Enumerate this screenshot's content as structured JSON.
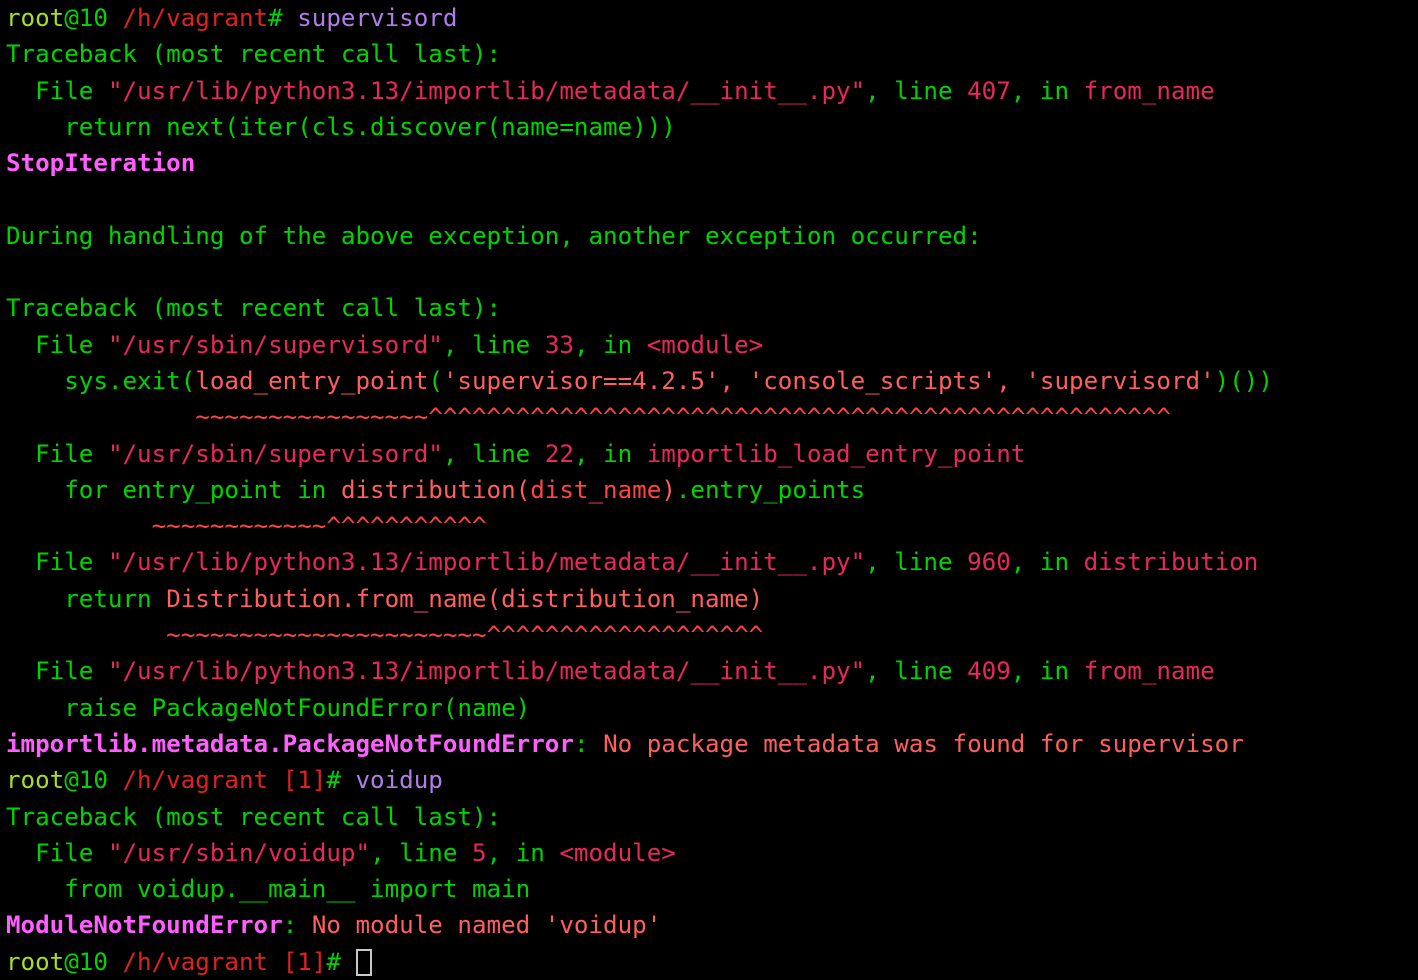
{
  "terminal": {
    "title": "root@10 /h/vagrant",
    "background": "#000000",
    "font_size_px": 24,
    "columns": 86,
    "rows": 27,
    "palette": {
      "green": "#00d400",
      "bright_green": "#33dd33",
      "yellow_green": "#aadd22",
      "red": "#ff4444",
      "salmon": "#ff5f5f",
      "dark_red": "#dd2222",
      "crimson": "#e8285a",
      "pink": "#e0205a",
      "magenta": "#ff5fff",
      "violet": "#b07ee8",
      "cursor": "#c8c8c8"
    },
    "cursor": {
      "shape": "hollow-block",
      "visible": true
    },
    "lines": [
      {
        "id": "prompt-1",
        "segments": [
          {
            "text": "root",
            "color": "#aadd22"
          },
          {
            "text": "@10",
            "color": "#00d400"
          },
          {
            "text": " ",
            "color": "#00d400"
          },
          {
            "text": "/h/vagrant",
            "color": "#dd2222"
          },
          {
            "text": "# ",
            "color": "#00d400"
          },
          {
            "text": "supervisord",
            "color": "#b07ee8"
          }
        ]
      },
      {
        "id": "traceback-header-1",
        "segments": [
          {
            "text": "Traceback (most recent call last):",
            "color": "#00d400"
          }
        ]
      },
      {
        "id": "frame-1-file",
        "segments": [
          {
            "text": "  File ",
            "color": "#00d400"
          },
          {
            "text": "\"/usr/lib/python3.13/importlib/metadata/__init__.py\"",
            "color": "#e8285a"
          },
          {
            "text": ", ",
            "color": "#00d400"
          },
          {
            "text": "line ",
            "color": "#00d400"
          },
          {
            "text": "407",
            "color": "#e8285a"
          },
          {
            "text": ", ",
            "color": "#00d400"
          },
          {
            "text": "in ",
            "color": "#00d400"
          },
          {
            "text": "from_name",
            "color": "#e8285a"
          }
        ]
      },
      {
        "id": "frame-1-code",
        "segments": [
          {
            "text": "    return next(iter(cls.discover(name=name)))",
            "color": "#00d400"
          }
        ]
      },
      {
        "id": "exception-1",
        "segments": [
          {
            "text": "StopIteration",
            "color": "#ff5fff",
            "bold": true
          }
        ]
      },
      {
        "id": "blank-1",
        "segments": [
          {
            "text": "",
            "color": "#00d400"
          }
        ]
      },
      {
        "id": "chain-message",
        "segments": [
          {
            "text": "During handling of the above exception, another exception occurred:",
            "color": "#00d400"
          }
        ]
      },
      {
        "id": "blank-2",
        "segments": [
          {
            "text": "",
            "color": "#00d400"
          }
        ]
      },
      {
        "id": "traceback-header-2",
        "segments": [
          {
            "text": "Traceback (most recent call last):",
            "color": "#00d400"
          }
        ]
      },
      {
        "id": "frame-2-file",
        "segments": [
          {
            "text": "  File ",
            "color": "#00d400"
          },
          {
            "text": "\"/usr/sbin/supervisord\"",
            "color": "#e8285a"
          },
          {
            "text": ", ",
            "color": "#00d400"
          },
          {
            "text": "line ",
            "color": "#00d400"
          },
          {
            "text": "33",
            "color": "#e8285a"
          },
          {
            "text": ", ",
            "color": "#00d400"
          },
          {
            "text": "in ",
            "color": "#00d400"
          },
          {
            "text": "<module>",
            "color": "#e8285a"
          }
        ]
      },
      {
        "id": "frame-2-code",
        "segments": [
          {
            "text": "    sys.exit(",
            "color": "#00d400"
          },
          {
            "text": "load_entry_point",
            "color": "#ff5f5f"
          },
          {
            "text": "(",
            "color": "#00d400"
          },
          {
            "text": "'supervisor==4.2.5', 'console_scripts', 'supervisord'",
            "color": "#ff5f5f"
          },
          {
            "text": ")())",
            "color": "#00d400"
          }
        ]
      },
      {
        "id": "frame-2-markers",
        "segments": [
          {
            "text": "             ~~~~~~~~~~~~~~~~^^^^^^^^^^^^^^^^^^^^^^^^^^^^^^^^^^^^^^^^^^^^^^^^^^^",
            "color": "#ff4444"
          }
        ]
      },
      {
        "id": "frame-3-file",
        "segments": [
          {
            "text": "  File ",
            "color": "#00d400"
          },
          {
            "text": "\"/usr/sbin/supervisord\"",
            "color": "#e8285a"
          },
          {
            "text": ", ",
            "color": "#00d400"
          },
          {
            "text": "line ",
            "color": "#00d400"
          },
          {
            "text": "22",
            "color": "#e8285a"
          },
          {
            "text": ", ",
            "color": "#00d400"
          },
          {
            "text": "in ",
            "color": "#00d400"
          },
          {
            "text": "importlib_load_entry_point",
            "color": "#e8285a"
          }
        ]
      },
      {
        "id": "frame-3-code",
        "segments": [
          {
            "text": "    for entry_point in ",
            "color": "#00d400"
          },
          {
            "text": "distribution",
            "color": "#ff5f5f"
          },
          {
            "text": "(",
            "color": "#ff5f5f"
          },
          {
            "text": "dist_name",
            "color": "#ff4444"
          },
          {
            "text": ")",
            "color": "#ff5f5f"
          },
          {
            "text": ".entry_points",
            "color": "#00d400"
          }
        ]
      },
      {
        "id": "frame-3-markers",
        "segments": [
          {
            "text": "          ~~~~~~~~~~~~^^^^^^^^^^^",
            "color": "#ff4444"
          }
        ]
      },
      {
        "id": "frame-4-file",
        "segments": [
          {
            "text": "  File ",
            "color": "#00d400"
          },
          {
            "text": "\"/usr/lib/python3.13/importlib/metadata/__init__.py\"",
            "color": "#e8285a"
          },
          {
            "text": ", ",
            "color": "#00d400"
          },
          {
            "text": "line ",
            "color": "#00d400"
          },
          {
            "text": "960",
            "color": "#e8285a"
          },
          {
            "text": ", ",
            "color": "#00d400"
          },
          {
            "text": "in ",
            "color": "#00d400"
          },
          {
            "text": "distribution",
            "color": "#e8285a"
          }
        ]
      },
      {
        "id": "frame-4-code",
        "segments": [
          {
            "text": "    return ",
            "color": "#00d400"
          },
          {
            "text": "Distribution.from_name",
            "color": "#ff5f5f"
          },
          {
            "text": "(distribution_name)",
            "color": "#ff5f5f"
          }
        ]
      },
      {
        "id": "frame-4-markers",
        "segments": [
          {
            "text": "           ~~~~~~~~~~~~~~~~~~~~~~^^^^^^^^^^^^^^^^^^^",
            "color": "#ff4444"
          }
        ]
      },
      {
        "id": "frame-5-file",
        "segments": [
          {
            "text": "  File ",
            "color": "#00d400"
          },
          {
            "text": "\"/usr/lib/python3.13/importlib/metadata/__init__.py\"",
            "color": "#e8285a"
          },
          {
            "text": ", ",
            "color": "#00d400"
          },
          {
            "text": "line ",
            "color": "#00d400"
          },
          {
            "text": "409",
            "color": "#e8285a"
          },
          {
            "text": ", ",
            "color": "#00d400"
          },
          {
            "text": "in ",
            "color": "#00d400"
          },
          {
            "text": "from_name",
            "color": "#e8285a"
          }
        ]
      },
      {
        "id": "frame-5-code",
        "segments": [
          {
            "text": "    raise PackageNotFoundError(name)",
            "color": "#00d400"
          }
        ]
      },
      {
        "id": "exception-2",
        "segments": [
          {
            "text": "importlib.metadata.PackageNotFoundError",
            "color": "#ff5fff",
            "bold": true
          },
          {
            "text": ": ",
            "color": "#00d400"
          },
          {
            "text": "No package metadata was found for supervisor",
            "color": "#ff5f5f"
          }
        ]
      },
      {
        "id": "prompt-2",
        "segments": [
          {
            "text": "root",
            "color": "#aadd22"
          },
          {
            "text": "@10",
            "color": "#00d400"
          },
          {
            "text": " ",
            "color": "#00d400"
          },
          {
            "text": "/h/vagrant",
            "color": "#dd2222"
          },
          {
            "text": " ",
            "color": "#00d400"
          },
          {
            "text": "[1]",
            "color": "#dd2222"
          },
          {
            "text": "# ",
            "color": "#00d400"
          },
          {
            "text": "voidup",
            "color": "#b07ee8"
          }
        ]
      },
      {
        "id": "traceback-header-3",
        "segments": [
          {
            "text": "Traceback (most recent call last):",
            "color": "#00d400"
          }
        ]
      },
      {
        "id": "frame-6-file",
        "segments": [
          {
            "text": "  File ",
            "color": "#00d400"
          },
          {
            "text": "\"/usr/sbin/voidup\"",
            "color": "#e8285a"
          },
          {
            "text": ", ",
            "color": "#00d400"
          },
          {
            "text": "line ",
            "color": "#00d400"
          },
          {
            "text": "5",
            "color": "#e8285a"
          },
          {
            "text": ", ",
            "color": "#00d400"
          },
          {
            "text": "in ",
            "color": "#00d400"
          },
          {
            "text": "<module>",
            "color": "#e8285a"
          }
        ]
      },
      {
        "id": "frame-6-code",
        "segments": [
          {
            "text": "    from voidup.__main__ import main",
            "color": "#00d400"
          }
        ]
      },
      {
        "id": "exception-3",
        "segments": [
          {
            "text": "ModuleNotFoundError",
            "color": "#ff5fff",
            "bold": true
          },
          {
            "text": ": ",
            "color": "#00d400"
          },
          {
            "text": "No module named 'voidup'",
            "color": "#ff5f5f"
          }
        ]
      },
      {
        "id": "prompt-3",
        "segments": [
          {
            "text": "root",
            "color": "#aadd22"
          },
          {
            "text": "@10",
            "color": "#00d400"
          },
          {
            "text": " ",
            "color": "#00d400"
          },
          {
            "text": "/h/vagrant",
            "color": "#dd2222"
          },
          {
            "text": " ",
            "color": "#00d400"
          },
          {
            "text": "[1]",
            "color": "#dd2222"
          },
          {
            "text": "# ",
            "color": "#00d400"
          }
        ],
        "cursor_after": true
      }
    ]
  }
}
